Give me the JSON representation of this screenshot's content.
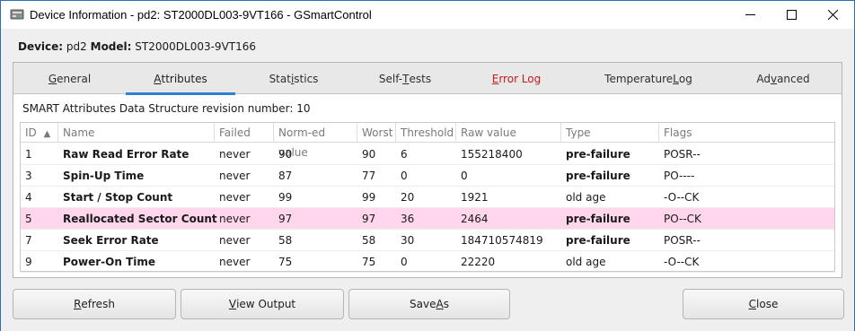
{
  "window": {
    "title": "Device Information - pd2: ST2000DL003-9VT166 - GSmartControl",
    "icon": "drive-icon"
  },
  "device": {
    "device_label": "Device:",
    "device_value": "pd2",
    "model_label": "Model:",
    "model_value": "ST2000DL003-9VT166"
  },
  "tabs": [
    {
      "pre": "",
      "mn": "G",
      "post": "eneral"
    },
    {
      "pre": "",
      "mn": "A",
      "post": "ttributes"
    },
    {
      "pre": "Stat",
      "mn": "i",
      "post": "stics"
    },
    {
      "pre": "Self-",
      "mn": "T",
      "post": "ests"
    },
    {
      "pre": "",
      "mn": "E",
      "post": "rror Log"
    },
    {
      "pre": "Temperature ",
      "mn": "L",
      "post": "og"
    },
    {
      "pre": "Ad",
      "mn": "v",
      "post": "anced"
    }
  ],
  "active_tab": "Attributes",
  "attributes": {
    "revision_text": "SMART Attributes Data Structure revision number: 10",
    "sort_indicator": "▲",
    "columns": [
      "ID",
      "Name",
      "Failed",
      "Norm-ed value",
      "Worst",
      "Threshold",
      "Raw value",
      "Type",
      "Flags"
    ],
    "rows": [
      [
        "1",
        "Raw Read Error Rate",
        "never",
        "90",
        "90",
        "6",
        "155218400",
        "pre-failure",
        "POSR--"
      ],
      [
        "3",
        "Spin-Up Time",
        "never",
        "87",
        "77",
        "0",
        "0",
        "pre-failure",
        "PO----"
      ],
      [
        "4",
        "Start / Stop Count",
        "never",
        "99",
        "99",
        "20",
        "1921",
        "old age",
        "-O--CK"
      ],
      [
        "5",
        "Reallocated Sector Count",
        "never",
        "97",
        "97",
        "36",
        "2464",
        "pre-failure",
        "PO--CK"
      ],
      [
        "7",
        "Seek Error Rate",
        "never",
        "58",
        "58",
        "30",
        "184710574819",
        "pre-failure",
        "POSR--"
      ],
      [
        "9",
        "Power-On Time",
        "never",
        "75",
        "75",
        "0",
        "22220",
        "old age",
        "-O--CK"
      ]
    ],
    "highlighted_row": 3
  },
  "buttons": {
    "refresh": {
      "pre": "",
      "mn": "R",
      "post": "efresh"
    },
    "view_output": {
      "pre": "",
      "mn": "V",
      "post": "iew Output"
    },
    "save_as": {
      "pre": "Save ",
      "mn": "A",
      "post": "s"
    },
    "close": {
      "pre": "",
      "mn": "C",
      "post": "lose"
    }
  },
  "colors": {
    "accent": "#2f7fd2",
    "error_tab": "#c01c1c",
    "warning_row": "#ffd6ec"
  }
}
